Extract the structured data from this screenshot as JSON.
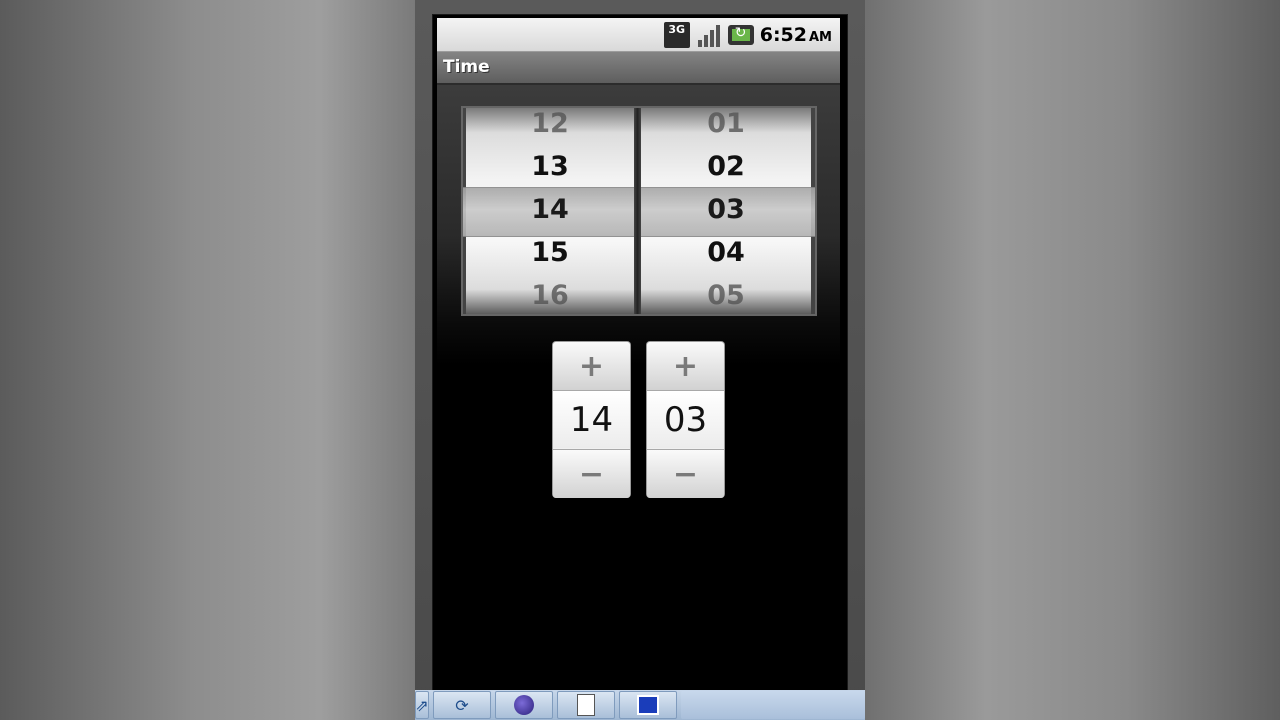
{
  "status_bar": {
    "network_label": "3G",
    "time": "6:52",
    "ampm": "AM"
  },
  "title_bar": {
    "title": "Time"
  },
  "wheel_picker": {
    "hours": [
      "12",
      "13",
      "14",
      "15",
      "16"
    ],
    "minutes": [
      "01",
      "02",
      "03",
      "04",
      "05"
    ]
  },
  "steppers": {
    "hour_value": "14",
    "minute_value": "03",
    "plus_glyph": "+",
    "minus_glyph": "−"
  },
  "taskbar": {
    "items": [
      "partial-window",
      "quicktime",
      "eclipse",
      "document",
      "emulator-window"
    ]
  }
}
